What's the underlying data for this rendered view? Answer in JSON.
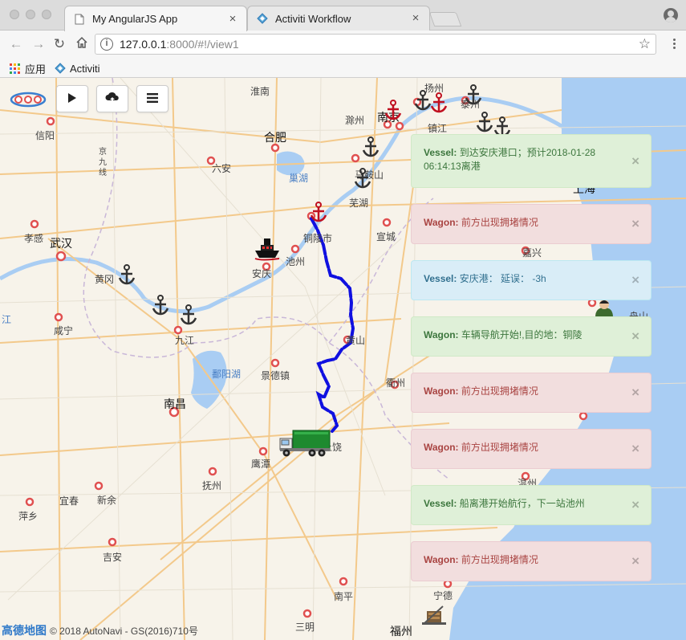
{
  "browser": {
    "tabs": [
      {
        "title": "My AngularJS App",
        "active": true
      },
      {
        "title": "Activiti Workflow",
        "active": false
      }
    ],
    "url_host": "127.0.0.1",
    "url_path": ":8000/#!/view1",
    "bookmarks": [
      {
        "label": "应用",
        "icon": "apps-grid-icon"
      },
      {
        "label": "Activiti",
        "icon": "activiti-diamond-icon"
      }
    ]
  },
  "map": {
    "controls": [
      {
        "name": "play-button",
        "icon": "play-icon"
      },
      {
        "name": "upload-button",
        "icon": "cloud-upload-icon"
      },
      {
        "name": "list-button",
        "icon": "list-icon"
      }
    ],
    "cities": [
      {
        "name": "淮南",
        "major": false
      },
      {
        "name": "扬州",
        "major": false
      },
      {
        "name": "泰州",
        "major": false
      },
      {
        "name": "信阳",
        "major": false
      },
      {
        "name": "合肥",
        "major": true
      },
      {
        "name": "滁州",
        "major": false
      },
      {
        "name": "南京",
        "major": true
      },
      {
        "name": "镇江",
        "major": false
      },
      {
        "name": "六安",
        "major": false
      },
      {
        "name": "京九线",
        "major": false
      },
      {
        "name": "巢湖",
        "major": false
      },
      {
        "name": "马鞍山",
        "major": false
      },
      {
        "name": "上海",
        "major": true
      },
      {
        "name": "芜湖",
        "major": false
      },
      {
        "name": "铜陵市",
        "major": false
      },
      {
        "name": "宣城",
        "major": false
      },
      {
        "name": "孝感",
        "major": false
      },
      {
        "name": "武汉",
        "major": true
      },
      {
        "name": "安庆",
        "major": false
      },
      {
        "name": "池州",
        "major": false
      },
      {
        "name": "嘉兴",
        "major": false
      },
      {
        "name": "黄冈",
        "major": false
      },
      {
        "name": "舟山",
        "major": false
      },
      {
        "name": "咸宁",
        "major": false
      },
      {
        "name": "九江",
        "major": false
      },
      {
        "name": "黄山",
        "major": false
      },
      {
        "name": "鄱阳湖",
        "major": false
      },
      {
        "name": "景德镇",
        "major": false
      },
      {
        "name": "衢州",
        "major": false
      },
      {
        "name": "南昌",
        "major": true
      },
      {
        "name": "上饶",
        "major": false
      },
      {
        "name": "鹰潭",
        "major": false
      },
      {
        "name": "抚州",
        "major": false
      },
      {
        "name": "温州",
        "major": false
      },
      {
        "name": "萍乡",
        "major": false
      },
      {
        "name": "宜春",
        "major": false
      },
      {
        "name": "新余",
        "major": false
      },
      {
        "name": "吉安",
        "major": false
      },
      {
        "name": "南平",
        "major": false
      },
      {
        "name": "宁德",
        "major": false
      },
      {
        "name": "三明",
        "major": false
      },
      {
        "name": "福州",
        "major": true
      },
      {
        "name": "江",
        "major": false
      }
    ],
    "attribution_logo": "高德地图",
    "attribution_text": "© 2018 AutoNavi - GS(2016)710号",
    "route_color": "#1010e0"
  },
  "alerts": [
    {
      "type": "success",
      "who": "Vessel:",
      "text": " 到达安庆港口；预计2018-01-28 06:14:13离港"
    },
    {
      "type": "danger",
      "who": "Wagon:",
      "text": " 前方出现拥堵情况"
    },
    {
      "type": "info",
      "who": "Vessel:",
      "text": " 安庆港：  延误：  -3h"
    },
    {
      "type": "success",
      "who": "Wagon:",
      "text": " 车辆导航开始!,目的地：铜陵"
    },
    {
      "type": "danger",
      "who": "Wagon:",
      "text": " 前方出现拥堵情况"
    },
    {
      "type": "danger",
      "who": "Wagon:",
      "text": " 前方出现拥堵情况"
    },
    {
      "type": "success",
      "who": "Vessel:",
      "text": " 船离港开始航行，下一站池州"
    },
    {
      "type": "danger",
      "who": "Wagon:",
      "text": " 前方出现拥堵情况"
    }
  ],
  "alert_close": "×"
}
